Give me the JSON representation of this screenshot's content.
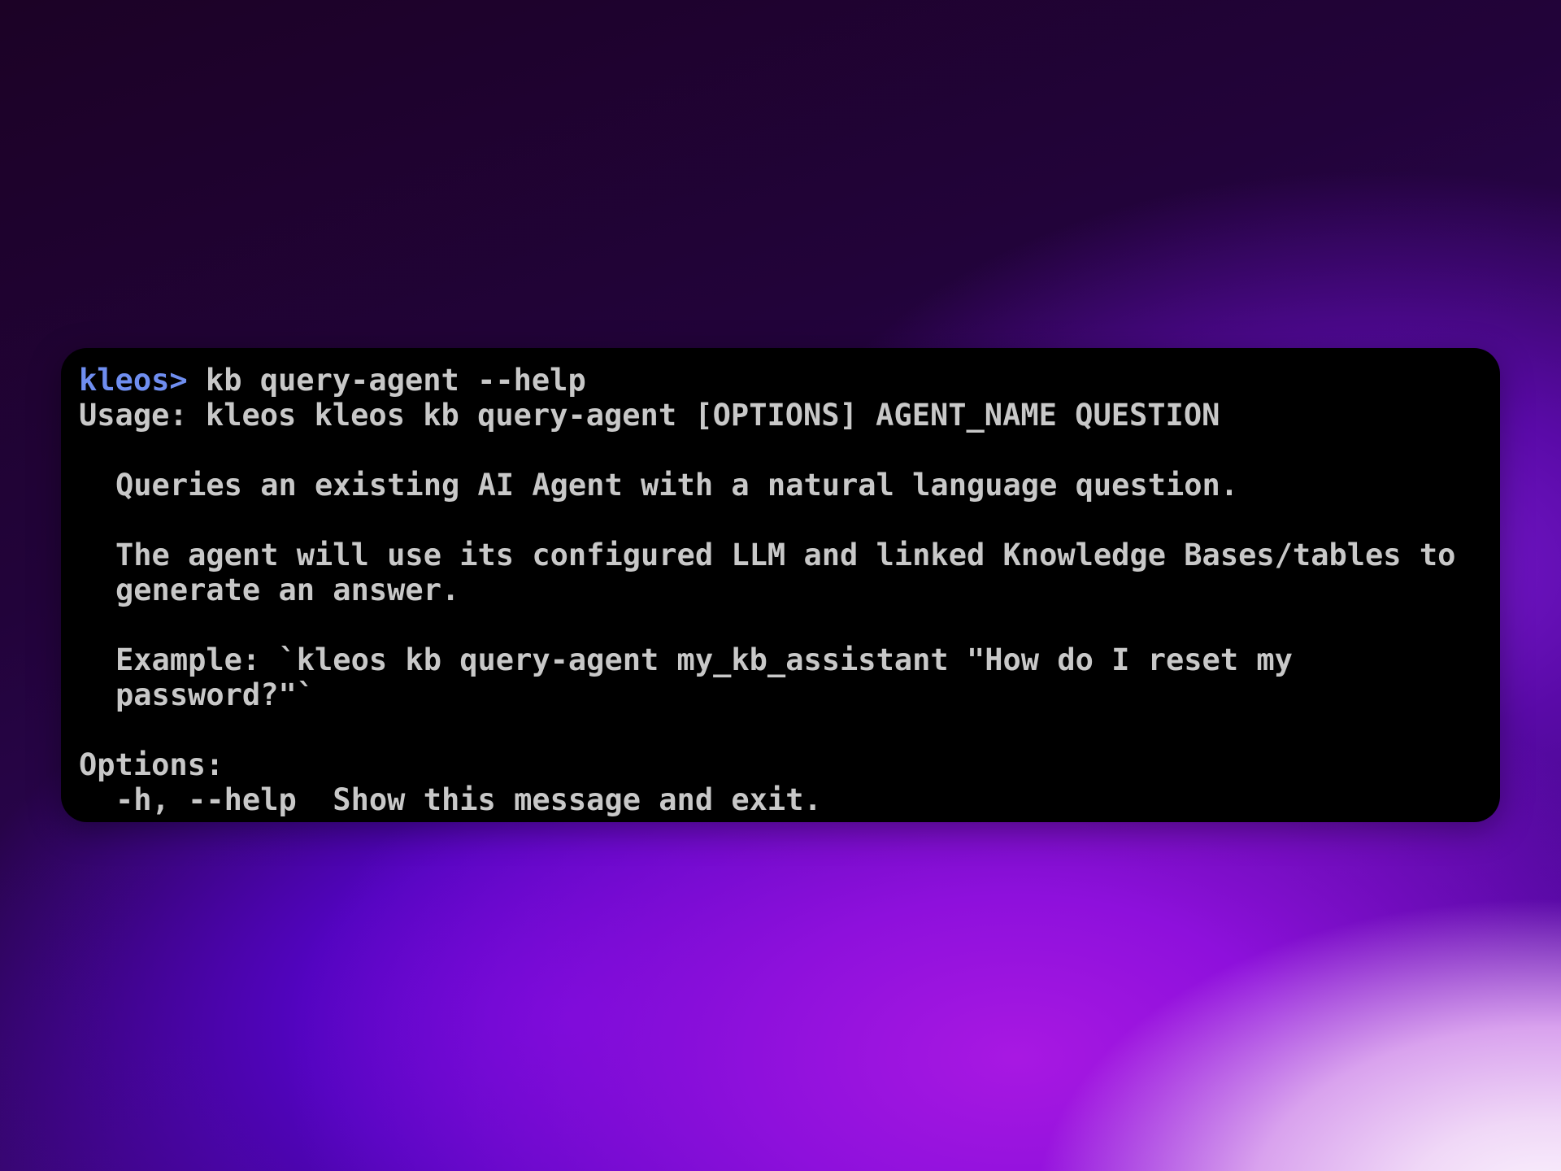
{
  "terminal": {
    "prompt": "kleos>",
    "command": " kb query-agent --help",
    "usage": "Usage: kleos kleos kb query-agent [OPTIONS] AGENT_NAME QUESTION",
    "description_1": "Queries an existing AI Agent with a natural language question.",
    "description_2_line1": "The agent will use its configured LLM and linked Knowledge Bases/tables to",
    "description_2_line2": "generate an answer.",
    "example_line1": "Example: `kleos kb query-agent my_kb_assistant \"How do I reset my",
    "example_line2": "password?\"`",
    "options_header": "Options:",
    "option_help": "-h, --help  Show this message and exit."
  },
  "colors": {
    "prompt": "#6f8ef0",
    "text": "#c8c8c8",
    "terminal_bg": "#000000"
  }
}
